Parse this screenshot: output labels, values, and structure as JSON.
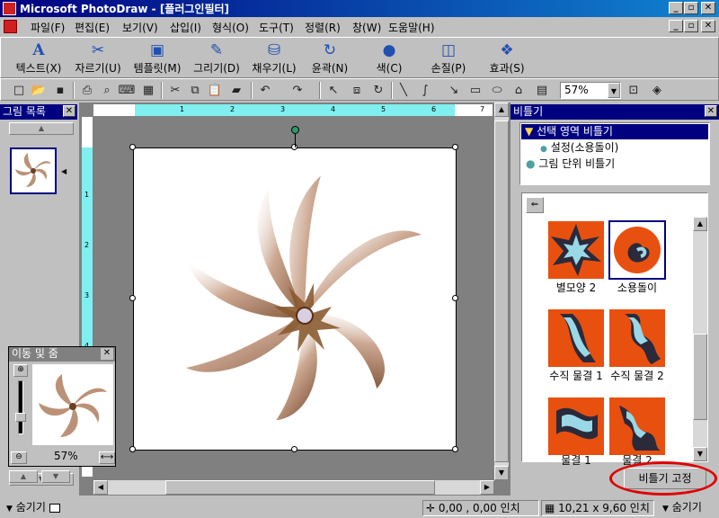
{
  "app": {
    "title": "Microsoft PhotoDraw - [플러그인필터]"
  },
  "menu": {
    "items": [
      "파일(F)",
      "편집(E)",
      "보기(V)",
      "삽입(I)",
      "형식(O)",
      "도구(T)",
      "정렬(R)",
      "창(W)",
      "도움말(H)"
    ]
  },
  "bigtoolbar": {
    "buttons": [
      {
        "label": "텍스트(X)",
        "icon": "text-a-icon"
      },
      {
        "label": "자르기(U)",
        "icon": "scissors-icon"
      },
      {
        "label": "템플릿(M)",
        "icon": "template-icon"
      },
      {
        "label": "그리기(D)",
        "icon": "pencil-icon"
      },
      {
        "label": "채우기(L)",
        "icon": "paint-bucket-icon"
      },
      {
        "label": "윤곽(N)",
        "icon": "outline-icon"
      },
      {
        "label": "색(C)",
        "icon": "color-icon"
      },
      {
        "label": "손질(P)",
        "icon": "touchup-icon"
      },
      {
        "label": "효과(S)",
        "icon": "effects-icon"
      }
    ]
  },
  "toolbar": {
    "zoom": "57%"
  },
  "panels": {
    "picture_list": {
      "title": "그림 목록"
    },
    "pan_zoom": {
      "title": "이동 및 줌",
      "zoom": "57%"
    }
  },
  "distort": {
    "title": "비틀기",
    "options": [
      "선택 영역 비틀기",
      "설정(소용돌이)",
      "그림 단위 비틀기"
    ],
    "gallery": [
      "별모양 2",
      "소용돌이",
      "수직 물결 1",
      "수직 물결 2",
      "물결 1",
      "물결 2"
    ],
    "fix_button": "비틀기 고정"
  },
  "status": {
    "hide_left": "숨기기",
    "position": "0,00 , 0,00 인치",
    "size": "10,21 x 9,60 인치",
    "hide_right": "숨기기"
  },
  "colors": {
    "titlebar": "#000080",
    "ruler_highlight": "#7fefef",
    "annotation_circle": "#e00000"
  }
}
